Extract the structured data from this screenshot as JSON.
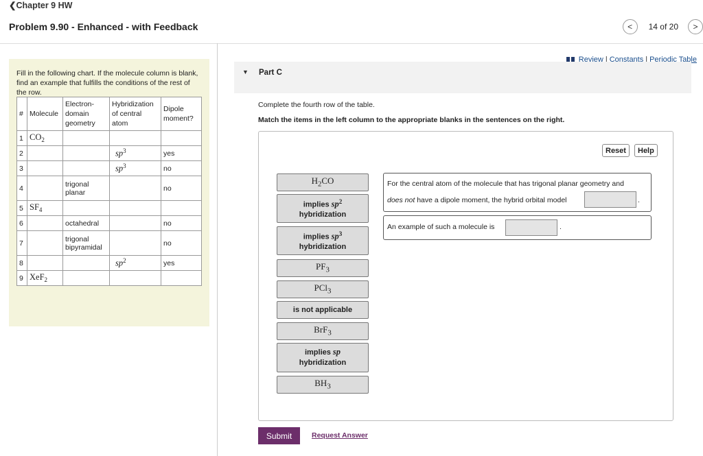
{
  "header": {
    "back_label": "Chapter 9 HW",
    "problem_title": "Problem 9.90 - Enhanced - with Feedback",
    "pager": {
      "prev": "<",
      "count": "14 of 20",
      "next": ">"
    }
  },
  "resources": {
    "review": "Review",
    "sep1": "|",
    "constants": "Constants",
    "sep2": "|",
    "periodic_table": "Periodic Table"
  },
  "left_panel": {
    "intro": "Fill in the following chart. If the molecule column is blank, find an example that fulfills the conditions of the rest of the row.",
    "columns": {
      "num": "#",
      "molecule": "Molecule",
      "geometry": "Electron-domain geometry",
      "hybridization": "Hybridization of central atom",
      "dipole": "Dipole moment?"
    },
    "rows": [
      {
        "num": "1",
        "mol_main": "CO",
        "mol_sub": "2",
        "geometry": "",
        "hyb_main": "",
        "hyb_sup": "",
        "dipole": ""
      },
      {
        "num": "2",
        "mol_main": "",
        "mol_sub": "",
        "geometry": "",
        "hyb_main": "sp",
        "hyb_sup": "3",
        "dipole": "yes"
      },
      {
        "num": "3",
        "mol_main": "",
        "mol_sub": "",
        "geometry": "",
        "hyb_main": "sp",
        "hyb_sup": "3",
        "dipole": "no"
      },
      {
        "num": "4",
        "mol_main": "",
        "mol_sub": "",
        "geometry": "trigonal planar",
        "hyb_main": "",
        "hyb_sup": "",
        "dipole": "no"
      },
      {
        "num": "5",
        "mol_main": "SF",
        "mol_sub": "4",
        "geometry": "",
        "hyb_main": "",
        "hyb_sup": "",
        "dipole": ""
      },
      {
        "num": "6",
        "mol_main": "",
        "mol_sub": "",
        "geometry": "octahedral",
        "hyb_main": "",
        "hyb_sup": "",
        "dipole": "no"
      },
      {
        "num": "7",
        "mol_main": "",
        "mol_sub": "",
        "geometry": "trigonal bipyramidal",
        "hyb_main": "",
        "hyb_sup": "",
        "dipole": "no"
      },
      {
        "num": "8",
        "mol_main": "",
        "mol_sub": "",
        "geometry": "",
        "hyb_main": "sp",
        "hyb_sup": "2",
        "dipole": "yes"
      },
      {
        "num": "9",
        "mol_main": "XeF",
        "mol_sub": "2",
        "geometry": "",
        "hyb_main": "",
        "hyb_sup": "",
        "dipole": ""
      }
    ]
  },
  "part": {
    "arrow": "▼",
    "title": "Part C",
    "instruction": "Complete the fourth row of the table.",
    "match_instruction": "Match the items in the left column to the appropriate blanks in the sentences on the right."
  },
  "controls": {
    "reset": "Reset",
    "help": "Help"
  },
  "tiles": {
    "h2co": {
      "main": "H",
      "sub": "2",
      "rest": "CO"
    },
    "sp2": {
      "pre": "implies ",
      "main": "sp",
      "sup": "2",
      "post": "hybridization"
    },
    "sp3": {
      "pre": "implies ",
      "main": "sp",
      "sup": "3",
      "post": "hybridization"
    },
    "pf3": {
      "main": "PF",
      "sub": "3"
    },
    "pcl3": {
      "main": "PCl",
      "sub": "3"
    },
    "na": {
      "label": "is not applicable"
    },
    "brf3": {
      "main": "BrF",
      "sub": "3"
    },
    "sp": {
      "pre": "implies ",
      "main": "sp",
      "post": "hybridization"
    },
    "bh3": {
      "main": "BH",
      "sub": "3"
    }
  },
  "sentences": {
    "s1_line1": "For the central atom of the molecule that has trigonal planar geometry and",
    "s1_em": "does not",
    "s1_line2": " have a dipole moment, the hybrid orbital model",
    "s1_end": ".",
    "s2_text": "An example of such a molecule is",
    "s2_end": "."
  },
  "footer": {
    "submit": "Submit",
    "request": "Request Answer"
  }
}
